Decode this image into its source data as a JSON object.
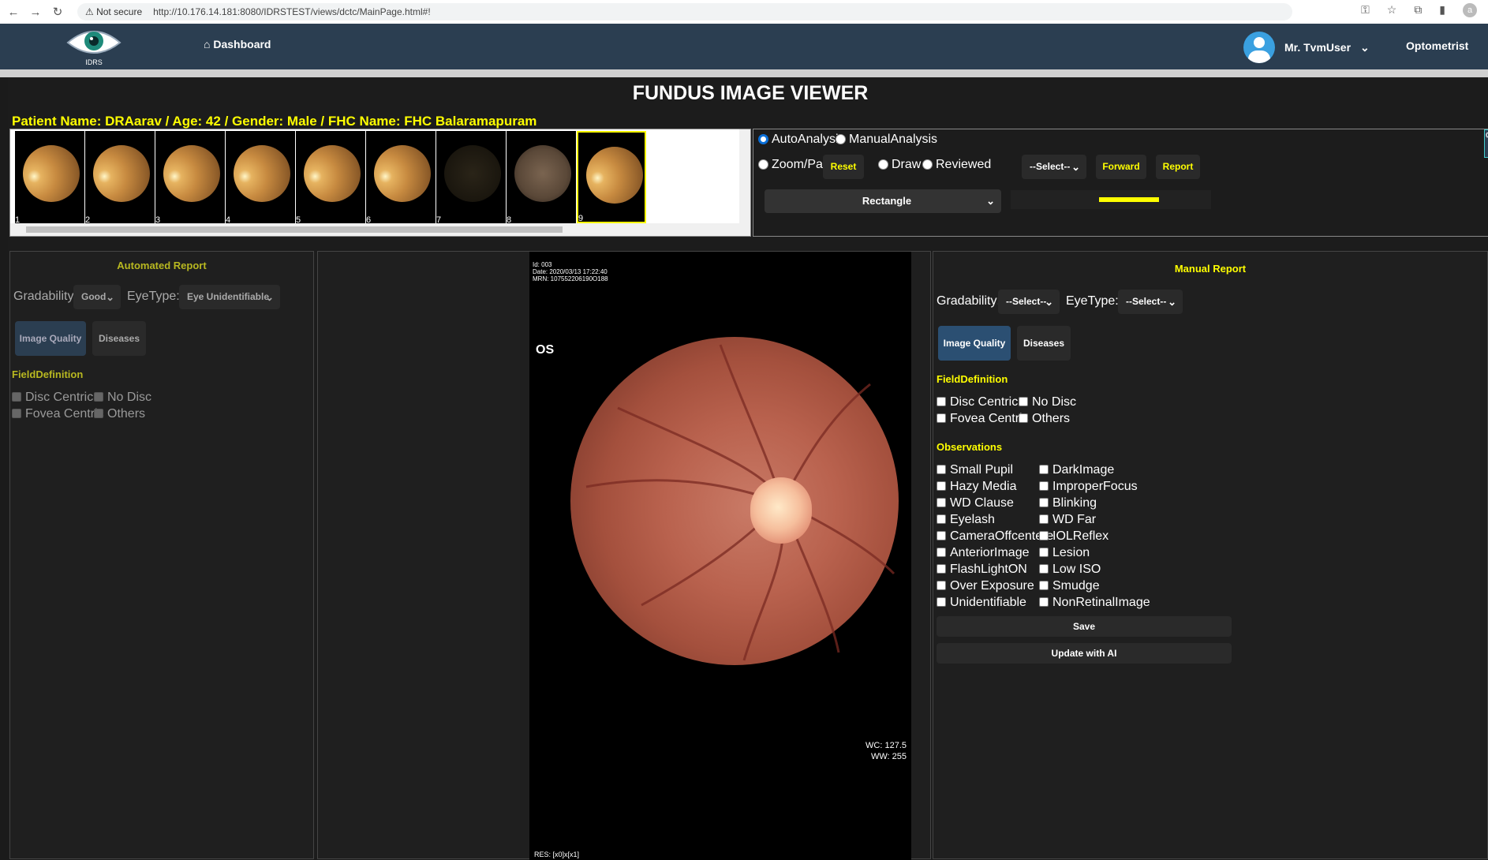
{
  "browser": {
    "security": "Not secure",
    "url": "http://10.176.14.181:8080/IDRSTEST/views/dctc/MainPage.html#!",
    "profile_initial": "a"
  },
  "appbar": {
    "logo_text": "IDRS",
    "dashboard_label": "Dashboard",
    "user_name": "Mr. TvmUser",
    "role": "Optometrist"
  },
  "page": {
    "title": "FUNDUS IMAGE VIEWER",
    "patient_info": "Patient Name: DRAarav /  Age: 42 /  Gender: Male /  FHC Name: FHC Balaramapuram"
  },
  "thumbnails": [
    {
      "num": "1",
      "tone": "bright"
    },
    {
      "num": "2",
      "tone": "bright"
    },
    {
      "num": "3",
      "tone": "bright"
    },
    {
      "num": "4",
      "tone": "bright"
    },
    {
      "num": "5",
      "tone": "bright"
    },
    {
      "num": "6",
      "tone": "bright"
    },
    {
      "num": "7",
      "tone": "dark"
    },
    {
      "num": "8",
      "tone": "dim"
    },
    {
      "num": "9",
      "tone": "bright",
      "selected": true
    }
  ],
  "controls": {
    "auto_analysis": "AutoAnalysis",
    "manual_analysis": "ManualAnalysis",
    "zoom_pan": "Zoom/Pan",
    "reset": "Reset",
    "draw": "Draw",
    "reviewed": "Reviewed",
    "select_placeholder": "--Select--",
    "forward": "Forward",
    "report": "Report",
    "shape": "Rectangle",
    "draw_color": "#ffff00"
  },
  "automated_report": {
    "heading": "Automated Report",
    "gradability_label": "Gradability:",
    "gradability_value": "Good",
    "eyetype_label": "EyeType:",
    "eyetype_value": "Eye Unidentifiable",
    "tab_image_quality": "Image Quality",
    "tab_diseases": "Diseases",
    "field_definition": "FieldDefinition",
    "fields": [
      "Disc Centric",
      "No Disc",
      "Fovea Centric",
      "Others"
    ]
  },
  "viewer": {
    "id_line": "Id: 003",
    "date_line": "Date: 2020/03/13 17:22:40",
    "mrn_line": "MRN: 107552206190O188",
    "eye_side": "OS",
    "wc": "WC: 127.5",
    "ww": "WW: 255",
    "res": "RES: [x0]x[x1]"
  },
  "manual_report": {
    "heading": "Manual Report",
    "gradability_label": "Gradability:",
    "gradability_value": "--Select--",
    "eyetype_label": "EyeType:",
    "eyetype_value": "--Select--",
    "tab_image_quality": "Image Quality",
    "tab_diseases": "Diseases",
    "field_definition": "FieldDefinition",
    "fields": [
      "Disc Centric",
      "No Disc",
      "Fovea Centric",
      "Others"
    ],
    "observations_title": "Observations",
    "observations_left": [
      "Small Pupil",
      "Hazy Media",
      "WD Clause",
      "Eyelash",
      "CameraOffcentere",
      "AnteriorImage",
      "FlashLightON",
      "Over Exposure",
      "Unidentifiable"
    ],
    "observations_right": [
      "DarkImage",
      "ImproperFocus",
      "Blinking",
      "WD Far",
      "IOLReflex",
      "Lesion",
      "Low ISO",
      "Smudge",
      "NonRetinalImage"
    ],
    "save": "Save",
    "update_ai": "Update with AI"
  },
  "colors": {
    "accent_yellow": "#ffff00",
    "header_bg": "#2b3e51",
    "olive_heading": "#b8b820"
  }
}
